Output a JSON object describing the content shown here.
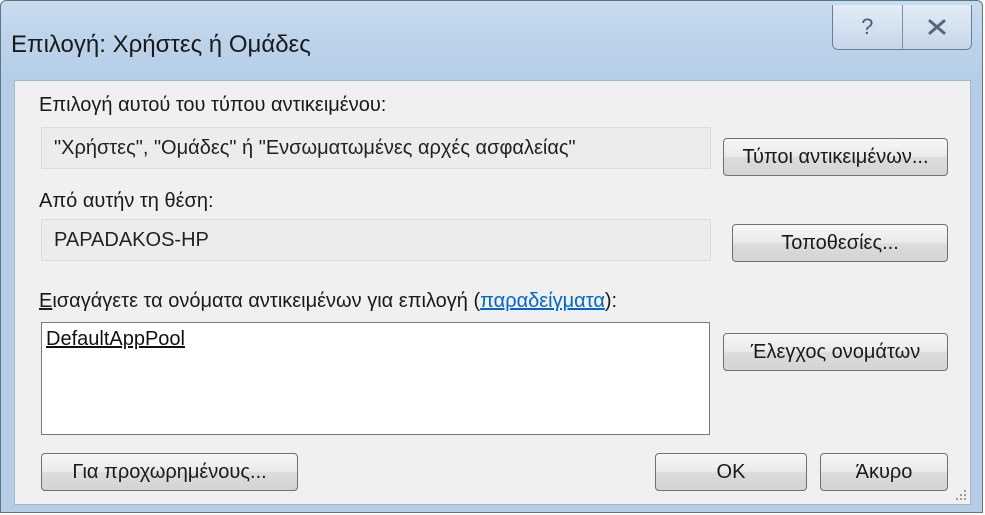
{
  "window": {
    "title": "Επιλογή: Χρήστες ή Ομάδες",
    "help_glyph": "?",
    "close_glyph": "x"
  },
  "object_type": {
    "label": "Επιλογή αυτού του τύπου αντικειμένου:",
    "value": "\"Χρήστες\", \"Ομάδες\" ή \"Ενσωματωμένες αρχές ασφαλείας\"",
    "button": "Τύποι αντικειμένων..."
  },
  "location": {
    "label": "Από αυτήν τη θέση:",
    "value": "PAPADAKOS-HP",
    "button": "Τοποθεσίες..."
  },
  "names": {
    "label_first_letter": "Ε",
    "label_rest": "ισαγάγετε τα ονόματα αντικειμένων για επιλογή (",
    "label_link": "παραδείγματα",
    "label_end": "):",
    "value": "DefaultAppPool",
    "check_button": "Έλεγχος ονομάτων"
  },
  "footer": {
    "advanced_button": "Για προχωρημένους...",
    "ok_button": "OK",
    "cancel_button": "Άκυρο"
  },
  "colors": {
    "frame": "#b5cde6",
    "client": "#f0f0f0",
    "link": "#0066cc"
  }
}
